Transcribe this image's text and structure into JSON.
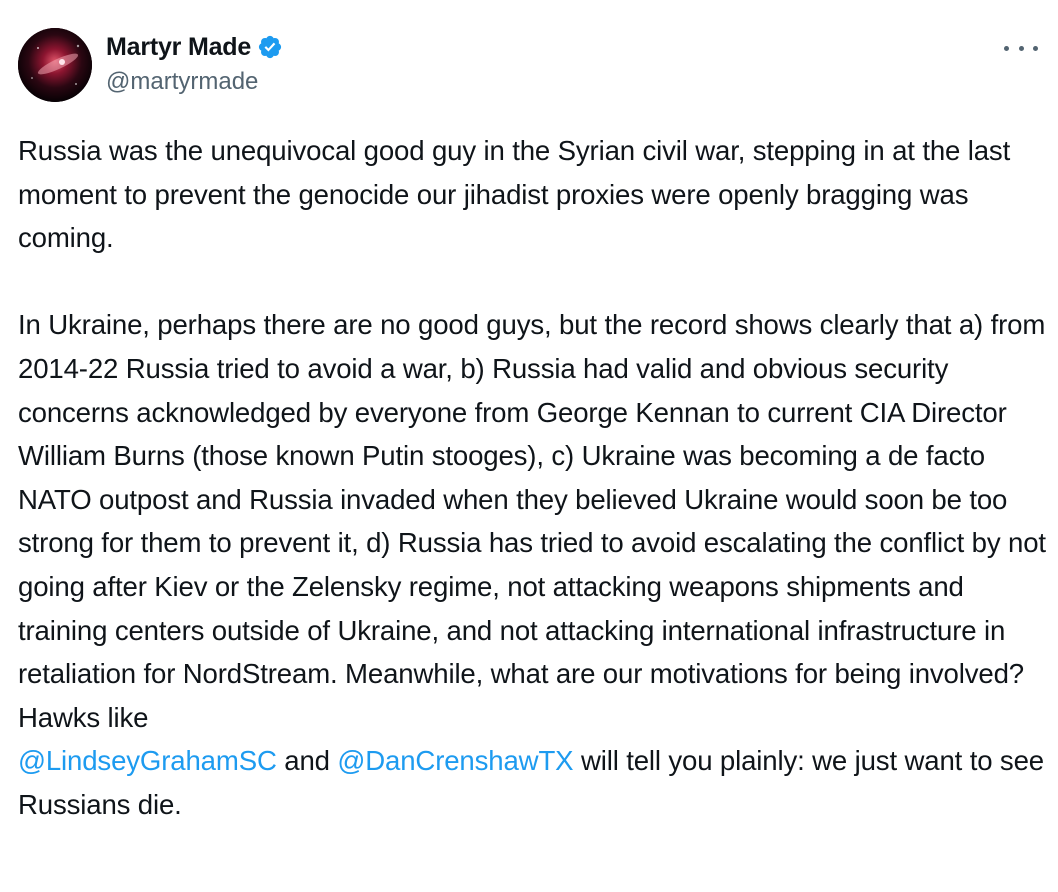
{
  "author": {
    "display_name": "Martyr Made",
    "handle": "@martyrmade",
    "verified": true,
    "verified_color": "#1d9bf0"
  },
  "icons": {
    "avatar": "avatar-image",
    "verified": "verified-badge-icon",
    "more": "more-options-icon"
  },
  "tweet": {
    "paragraph1": "Russia was the unequivocal good guy in the Syrian civil war, stepping in at the last moment to prevent the genocide our jihadist proxies were openly bragging was coming.",
    "paragraph2_part1": "In Ukraine, perhaps there are no good guys, but the record shows clearly that a) from 2014-22 Russia tried to avoid a war, b) Russia had valid and obvious security concerns acknowledged by everyone from George Kennan to current CIA Director William Burns (those known Putin stooges), c) Ukraine was becoming a de facto NATO outpost and Russia invaded when they believed Ukraine would soon be too strong for them to prevent it, d) Russia has tried to avoid escalating the conflict by not going after Kiev or the Zelensky regime, not attacking weapons shipments and training centers outside of Ukraine, and not attacking international infrastructure in retaliation for NordStream. Meanwhile, what are our motivations for being involved? Hawks like",
    "mention1": "@LindseyGrahamSC",
    "connector": "and",
    "mention2": "@DanCrenshawTX",
    "paragraph2_part2": "will tell you plainly: we just want to see Russians die."
  },
  "colors": {
    "text": "#0f1419",
    "secondary": "#536471",
    "link": "#1d9bf0"
  }
}
